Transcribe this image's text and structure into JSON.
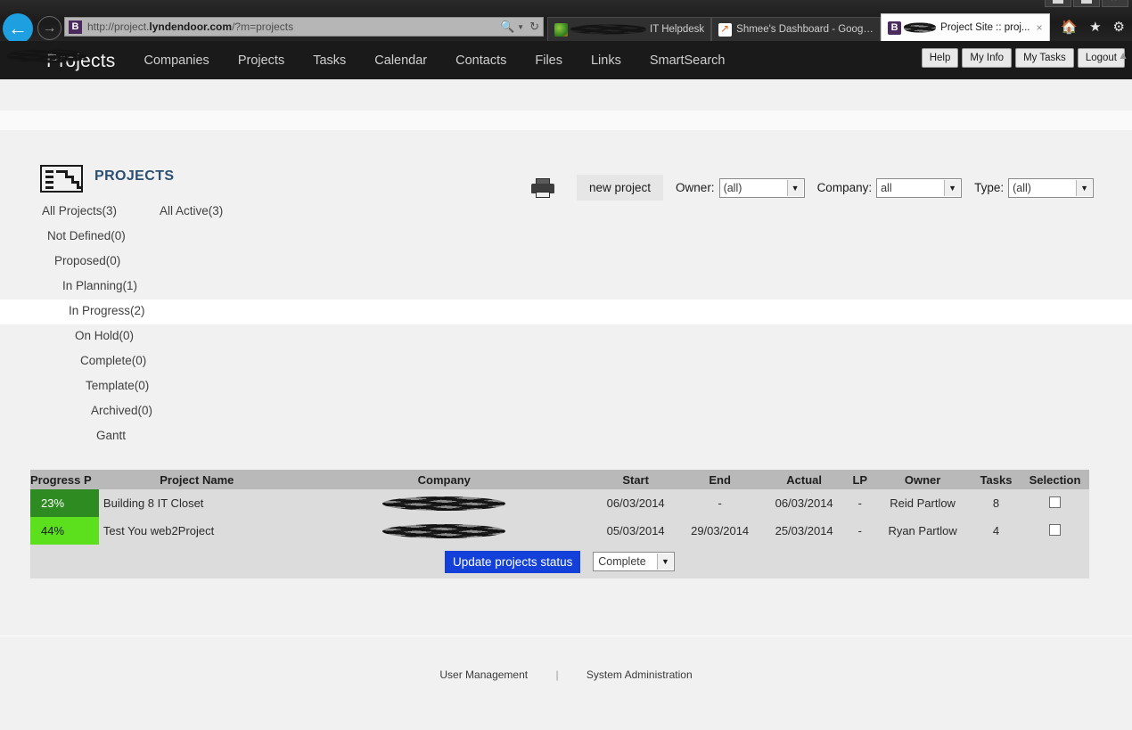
{
  "browser": {
    "back_icon": "back-arrow-icon",
    "forward_icon": "forward-arrow-icon",
    "favicon_letter": "B",
    "address_prefix": "http://project.",
    "address_domain": "lyndendoor.com",
    "address_suffix": "/?m=projects",
    "search_icon": "search-icon",
    "dropdown_icon": "chevron-down-icon",
    "refresh_icon": "refresh-icon",
    "home_icon": "home-icon",
    "favorites_icon": "star-icon",
    "settings_icon": "gear-icon",
    "tabs": [
      {
        "label": "IT Helpdesk",
        "redacted_prefix": true,
        "active": false,
        "icon": "green-globe-icon"
      },
      {
        "label": "Shmee's Dashboard - Googl...",
        "redacted_prefix": false,
        "active": false,
        "icon": "chart-icon"
      },
      {
        "label": "Project Site :: proj...",
        "redacted_prefix": true,
        "active": true,
        "icon": "purple-b-icon",
        "close_label": "×"
      }
    ]
  },
  "site_nav": {
    "brand_redacted": true,
    "brand_text": "Projects",
    "links": [
      "Companies",
      "Projects",
      "Tasks",
      "Calendar",
      "Contacts",
      "Files",
      "Links",
      "SmartSearch"
    ],
    "buttons": [
      "Help",
      "My Info",
      "My Tasks",
      "Logout"
    ]
  },
  "page": {
    "icon": "gantt-chart-icon",
    "title": "PROJECTS",
    "accent_color": "#2b4f72"
  },
  "toolbar": {
    "print_icon": "printer-icon",
    "new_project_label": "new project",
    "filters": [
      {
        "label": "Owner:",
        "value": "(all)"
      },
      {
        "label": "Company:",
        "value": "all"
      },
      {
        "label": "Type:",
        "value": "(all)"
      }
    ]
  },
  "filter_tree": [
    {
      "label": "All Projects(3)",
      "indent": 0,
      "active": false
    },
    {
      "label": "All Active(3)",
      "indent": 1,
      "active": false
    },
    {
      "label": "Not Defined(0)",
      "indent": 1,
      "active": false
    },
    {
      "label": "Proposed(0)",
      "indent": 2,
      "active": false
    },
    {
      "label": "In Planning(1)",
      "indent": 3,
      "active": false
    },
    {
      "label": "In Progress(2)",
      "indent": 4,
      "active": true
    },
    {
      "label": "On Hold(0)",
      "indent": 5,
      "active": false
    },
    {
      "label": "Complete(0)",
      "indent": 6,
      "active": false
    },
    {
      "label": "Template(0)",
      "indent": 7,
      "active": false
    },
    {
      "label": "Archived(0)",
      "indent": 8,
      "active": false
    },
    {
      "label": "Gantt",
      "indent": 9,
      "active": false
    }
  ],
  "table": {
    "headers": [
      "Progress P",
      "Project Name",
      "Company",
      "Start",
      "End",
      "Actual",
      "LP",
      "Owner",
      "Tasks",
      "Selection"
    ],
    "rows": [
      {
        "progress": "23%",
        "progress_color": "#2e8b21",
        "progress_text_color": "#ffffff",
        "name": "Building 8 IT Closet",
        "company_redacted": true,
        "start": "06/03/2014",
        "end": "-",
        "actual": "06/03/2014",
        "lp": "-",
        "owner": "Reid Partlow",
        "tasks": "8",
        "selected": false
      },
      {
        "progress": "44%",
        "progress_color": "#5ce01e",
        "progress_text_color": "#1a1a1a",
        "name": "Test You web2Project",
        "company_redacted": true,
        "start": "05/03/2014",
        "end": "29/03/2014",
        "actual": "25/03/2014",
        "lp": "-",
        "owner": "Ryan Partlow",
        "tasks": "4",
        "selected": false
      }
    ],
    "update_button_label": "Update projects status",
    "update_button_color": "#1240d8",
    "status_select_value": "Complete"
  },
  "footer": {
    "user_management": "User Management",
    "divider": "|",
    "system_administration": "System Administration"
  }
}
